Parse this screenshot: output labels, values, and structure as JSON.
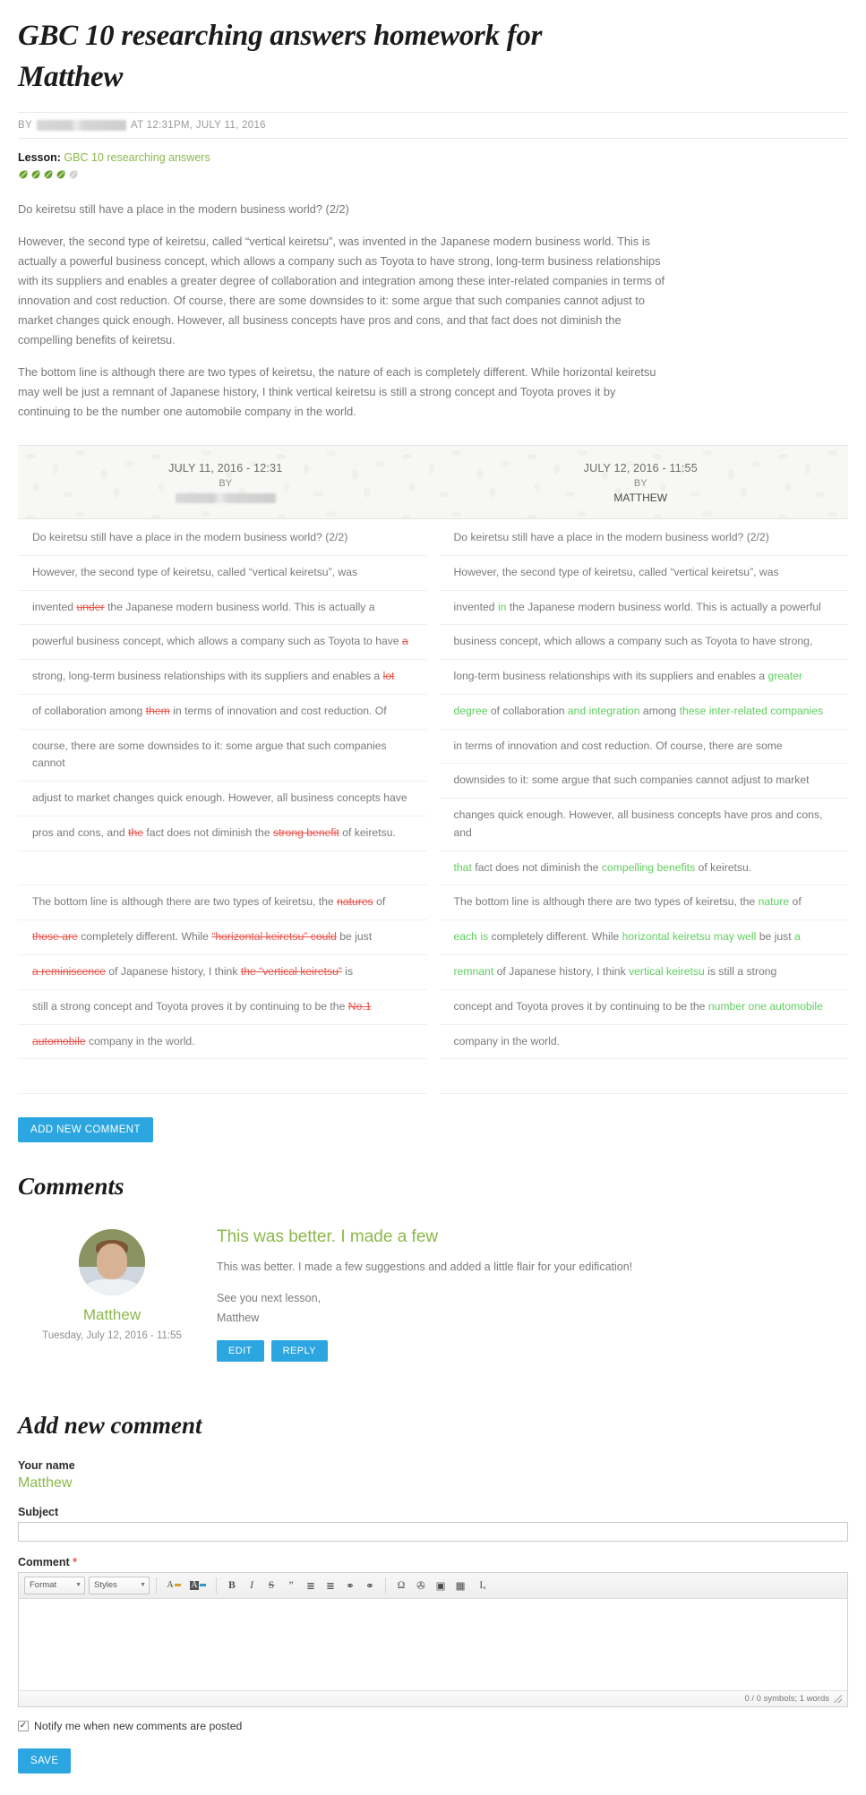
{
  "article": {
    "title": "GBC 10 researching answers homework for Matthew",
    "byline_prefix": "BY",
    "byline_author_redacted": true,
    "byline_time": "AT 12:31PM, JULY 11, 2016",
    "lesson_label": "Lesson:",
    "lesson_link": "GBC 10 researching answers",
    "rating": {
      "filled": 4,
      "total": 5,
      "filled_color": "#6aa12e",
      "empty_color": "#cfcfcf"
    },
    "paragraphs": [
      "Do keiretsu still have a place in the modern business world? (2/2)",
      "However, the second type of keiretsu, called “vertical keiretsu”, was invented in the Japanese modern business world. This is actually a powerful business concept, which allows a company such as Toyota to have strong, long-term business relationships with its suppliers and enables a greater degree of collaboration and integration among these inter-related companies in terms of innovation and cost reduction. Of course, there are some downsides to it: some argue that such companies cannot adjust to market changes quick enough. However, all business concepts have pros and cons, and that fact does not diminish the compelling benefits of keiretsu.",
      "The bottom line is although there are two types of keiretsu, the nature of each is completely different. While horizontal keiretsu may well be just a remnant of Japanese history, I think vertical keiretsu is still a strong concept and Toyota proves it by continuing to be the number one automobile company in the world."
    ]
  },
  "diff": {
    "left_header": {
      "datetime": "JULY 11, 2016 - 12:31",
      "by_label": "BY",
      "author_redacted": true
    },
    "right_header": {
      "datetime": "JULY 12, 2016 - 11:55",
      "by_label": "BY",
      "author": "MATTHEW"
    },
    "colors": {
      "deletion": "#e8554d",
      "addition": "#5fcf5f"
    },
    "left_rows": [
      [
        {
          "t": "Do keiretsu still have a place in the modern business world? (2/2)",
          "k": "same"
        }
      ],
      [
        {
          "t": "However, the second type of keiretsu, called “vertical keiretsu”, was",
          "k": "same"
        }
      ],
      [
        {
          "t": "invented ",
          "k": "same"
        },
        {
          "t": "under",
          "k": "del"
        },
        {
          "t": " the Japanese modern business world. This is actually a",
          "k": "same"
        }
      ],
      [
        {
          "t": "powerful business concept, which allows a company such as Toyota to have ",
          "k": "same"
        },
        {
          "t": "a",
          "k": "del"
        }
      ],
      [
        {
          "t": "strong, long-term business relationships with its suppliers and enables a ",
          "k": "same"
        },
        {
          "t": "lot",
          "k": "del"
        }
      ],
      [
        {
          "t": "of collaboration among ",
          "k": "same"
        },
        {
          "t": "them",
          "k": "del"
        },
        {
          "t": " in terms of innovation and cost reduction. Of",
          "k": "same"
        }
      ],
      [
        {
          "t": "course, there are some downsides to it: some argue that such companies cannot",
          "k": "same"
        }
      ],
      [
        {
          "t": "adjust to market changes quick enough. However, all business concepts have",
          "k": "same"
        }
      ],
      [
        {
          "t": "pros and cons, and ",
          "k": "same"
        },
        {
          "t": "the",
          "k": "del"
        },
        {
          "t": " fact does not diminish the ",
          "k": "same"
        },
        {
          "t": "strong benefit",
          "k": "del"
        },
        {
          "t": " of keiretsu.",
          "k": "same"
        }
      ],
      [],
      [
        {
          "t": "The bottom line is although there are two types of keiretsu, the ",
          "k": "same"
        },
        {
          "t": "natures",
          "k": "del"
        },
        {
          "t": " of",
          "k": "same"
        }
      ],
      [
        {
          "t": "those are",
          "k": "del"
        },
        {
          "t": " completely different. While ",
          "k": "same"
        },
        {
          "t": "“horizontal keiretsu” could",
          "k": "del"
        },
        {
          "t": " be just",
          "k": "same"
        }
      ],
      [
        {
          "t": "a reminiscence",
          "k": "del"
        },
        {
          "t": " of Japanese history, I think ",
          "k": "same"
        },
        {
          "t": "the “vertical keiretsu”",
          "k": "del"
        },
        {
          "t": " is",
          "k": "same"
        }
      ],
      [
        {
          "t": "still a strong concept and Toyota proves it by continuing to be the ",
          "k": "same"
        },
        {
          "t": "No.1",
          "k": "del"
        }
      ],
      [
        {
          "t": "automobile",
          "k": "del"
        },
        {
          "t": " company in the world.",
          "k": "same"
        }
      ],
      []
    ],
    "right_rows": [
      [
        {
          "t": "Do keiretsu still have a place in the modern business world? (2/2)",
          "k": "same"
        }
      ],
      [
        {
          "t": "However, the second type of keiretsu, called “vertical keiretsu”, was",
          "k": "same"
        }
      ],
      [
        {
          "t": "invented ",
          "k": "same"
        },
        {
          "t": "in",
          "k": "ins"
        },
        {
          "t": " the Japanese modern business world. This is actually a powerful",
          "k": "same"
        }
      ],
      [
        {
          "t": "business concept, which allows a company such as Toyota to have strong,",
          "k": "same"
        }
      ],
      [
        {
          "t": "long-term business relationships with its suppliers and enables a ",
          "k": "same"
        },
        {
          "t": "greater",
          "k": "ins"
        }
      ],
      [
        {
          "t": "degree",
          "k": "ins"
        },
        {
          "t": " of collaboration ",
          "k": "same"
        },
        {
          "t": "and integration",
          "k": "ins"
        },
        {
          "t": " among ",
          "k": "same"
        },
        {
          "t": "these inter-related companies",
          "k": "ins"
        }
      ],
      [
        {
          "t": "in terms of innovation and cost reduction. Of course, there are some",
          "k": "same"
        }
      ],
      [
        {
          "t": "downsides to it: some argue that such companies cannot adjust to market",
          "k": "same"
        }
      ],
      [
        {
          "t": "changes quick enough. However, all business concepts have pros and cons, and",
          "k": "same"
        }
      ],
      [
        {
          "t": "that",
          "k": "ins"
        },
        {
          "t": " fact does not diminish the ",
          "k": "same"
        },
        {
          "t": "compelling benefits",
          "k": "ins"
        },
        {
          "t": " of keiretsu.",
          "k": "same"
        }
      ],
      [
        {
          "t": "The bottom line is although there are two types of keiretsu, the ",
          "k": "same"
        },
        {
          "t": "nature",
          "k": "ins"
        },
        {
          "t": " of",
          "k": "same"
        }
      ],
      [
        {
          "t": "each is",
          "k": "ins"
        },
        {
          "t": " completely different. While ",
          "k": "same"
        },
        {
          "t": "horizontal keiretsu may well",
          "k": "ins"
        },
        {
          "t": " be just ",
          "k": "same"
        },
        {
          "t": "a",
          "k": "ins"
        }
      ],
      [
        {
          "t": "remnant",
          "k": "ins"
        },
        {
          "t": " of Japanese history, I think ",
          "k": "same"
        },
        {
          "t": "vertical keiretsu",
          "k": "ins"
        },
        {
          "t": " is still a strong",
          "k": "same"
        }
      ],
      [
        {
          "t": "concept and Toyota proves it by continuing to be the ",
          "k": "same"
        },
        {
          "t": "number one automobile",
          "k": "ins"
        }
      ],
      [
        {
          "t": "company in the world.",
          "k": "same"
        }
      ],
      []
    ]
  },
  "add_comment_button": "ADD NEW COMMENT",
  "comments_heading": "Comments",
  "comment": {
    "author": "Matthew",
    "date": "Tuesday, July 12, 2016 - 11:55",
    "title": "This was better. I made a few",
    "body_lines": [
      "This was better. I made a few suggestions and added a little flair for your edification!",
      "See you next lesson,\nMatthew"
    ],
    "edit_label": "EDIT",
    "reply_label": "REPLY"
  },
  "form": {
    "heading": "Add new comment",
    "name_label": "Your name",
    "name_value": "Matthew",
    "subject_label": "Subject",
    "subject_value": "",
    "comment_label": "Comment",
    "required_mark": "*",
    "editor": {
      "format_combo": "Format",
      "styles_combo": "Styles",
      "status": "0 / 0 symbols; 1 words",
      "buttons": [
        {
          "name": "text-color-icon",
          "glyph": "A"
        },
        {
          "name": "background-color-icon",
          "glyph": "A"
        },
        {
          "name": "bold-icon",
          "glyph": "B"
        },
        {
          "name": "italic-icon",
          "glyph": "I"
        },
        {
          "name": "strikethrough-icon",
          "glyph": "S"
        },
        {
          "name": "blockquote-icon",
          "glyph": "”"
        },
        {
          "name": "numbered-list-icon",
          "glyph": "≣"
        },
        {
          "name": "bulleted-list-icon",
          "glyph": "≣"
        },
        {
          "name": "link-icon",
          "glyph": "⚭"
        },
        {
          "name": "unlink-icon",
          "glyph": "⚭"
        },
        {
          "name": "special-char-icon",
          "glyph": "Ω"
        },
        {
          "name": "insert-media-icon",
          "glyph": "✇"
        },
        {
          "name": "insert-image-icon",
          "glyph": "▣"
        },
        {
          "name": "insert-table-icon",
          "glyph": "▦"
        },
        {
          "name": "remove-format-icon",
          "glyph": "Iₓ"
        }
      ]
    },
    "notify_label": "Notify me when new comments are posted",
    "notify_checked": true,
    "save_label": "SAVE"
  }
}
